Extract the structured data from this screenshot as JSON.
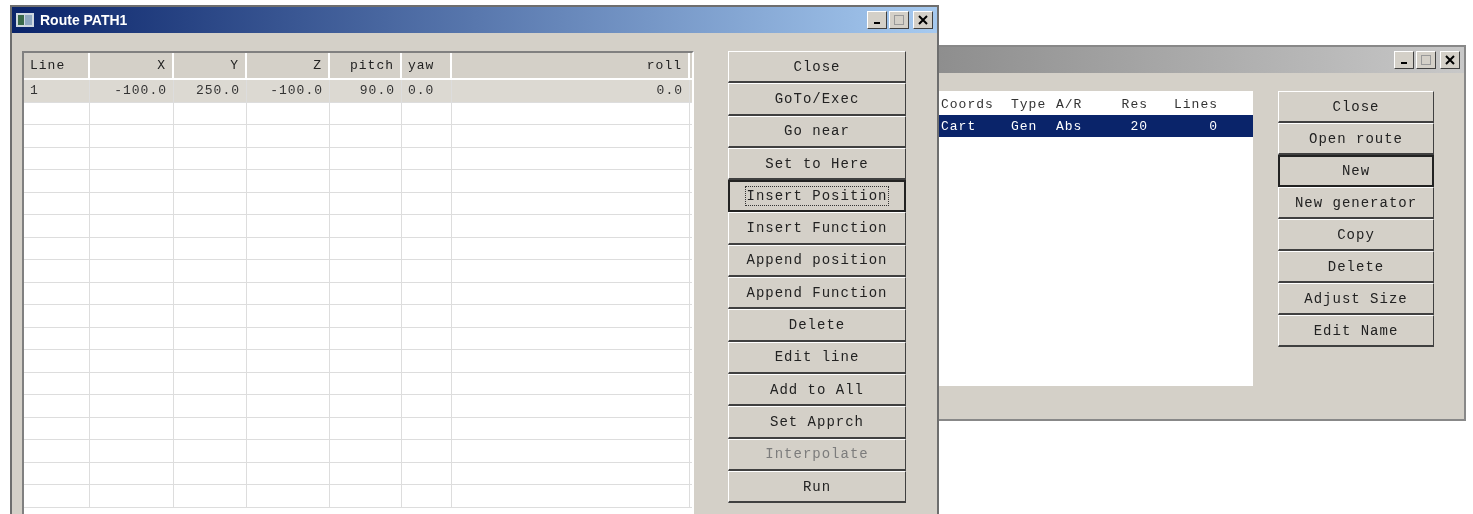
{
  "windows": [
    {
      "active": false,
      "list": {
        "columns": [
          "Coords",
          "Type",
          "A/R",
          "Res",
          "Lines"
        ],
        "rows": [
          {
            "cells": [
              "Cart",
              "Gen",
              "Abs",
              "20",
              "0"
            ],
            "selected": true
          }
        ]
      },
      "buttons": [
        {
          "label": "Close",
          "default": false,
          "focused": false,
          "disabled": false
        },
        {
          "label": "Open route",
          "default": false,
          "focused": false,
          "disabled": false
        },
        {
          "label": "New",
          "default": true,
          "focused": false,
          "disabled": false
        },
        {
          "label": "New generator",
          "default": false,
          "focused": false,
          "disabled": false
        },
        {
          "label": "Copy",
          "default": false,
          "focused": false,
          "disabled": false
        },
        {
          "label": "Delete",
          "default": false,
          "focused": false,
          "disabled": false
        },
        {
          "label": "Adjust Size",
          "default": false,
          "focused": false,
          "disabled": false
        },
        {
          "label": "Edit Name",
          "default": false,
          "focused": false,
          "disabled": false
        }
      ]
    },
    {
      "title": "Route PATH1",
      "active": true,
      "list": {
        "columns": [
          "Line",
          "X",
          "Y",
          "Z",
          "pitch",
          "yaw",
          "roll"
        ],
        "rows": [
          {
            "cells": [
              "1",
              "-100.0",
              "250.0",
              "-100.0",
              "90.0",
              "0.0",
              "0.0"
            ],
            "selected": false
          }
        ]
      },
      "buttons": [
        {
          "label": "Close",
          "default": false,
          "focused": false,
          "disabled": false
        },
        {
          "label": "GoTo/Exec",
          "default": false,
          "focused": false,
          "disabled": false
        },
        {
          "label": "Go near",
          "default": false,
          "focused": false,
          "disabled": false
        },
        {
          "label": "Set to Here",
          "default": false,
          "focused": false,
          "disabled": false
        },
        {
          "label": "Insert Position",
          "default": true,
          "focused": true,
          "disabled": false
        },
        {
          "label": "Insert Function",
          "default": false,
          "focused": false,
          "disabled": false
        },
        {
          "label": "Append position",
          "default": false,
          "focused": false,
          "disabled": false
        },
        {
          "label": "Append Function",
          "default": false,
          "focused": false,
          "disabled": false
        },
        {
          "label": "Delete",
          "default": false,
          "focused": false,
          "disabled": false
        },
        {
          "label": "Edit line",
          "default": false,
          "focused": false,
          "disabled": false
        },
        {
          "label": "Add to All",
          "default": false,
          "focused": false,
          "disabled": false
        },
        {
          "label": "Set Apprch",
          "default": false,
          "focused": false,
          "disabled": false
        },
        {
          "label": "Interpolate",
          "default": false,
          "focused": false,
          "disabled": true
        },
        {
          "label": "Run",
          "default": false,
          "focused": false,
          "disabled": false
        }
      ]
    }
  ]
}
